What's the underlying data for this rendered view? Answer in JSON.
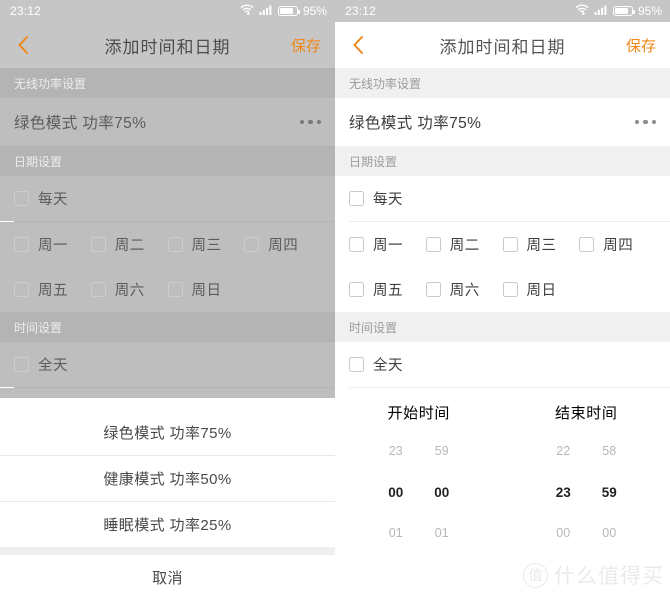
{
  "statusbar": {
    "time": "23:12",
    "battery_percent": "95%",
    "wifi_icon": "wifi-icon",
    "signal_icon": "signal-bars-icon",
    "battery_icon": "battery-icon"
  },
  "header": {
    "back_icon": "back-chevron-icon",
    "title": "添加时间和日期",
    "save_label": "保存",
    "accent_color": "#f0881a"
  },
  "sections": {
    "power": {
      "header": "无线功率设置",
      "row_label": "绿色模式 功率75%",
      "more_icon": "more-horizontal-icon"
    },
    "date": {
      "header": "日期设置",
      "all_days_label": "每天",
      "weekdays_row1": [
        "周一",
        "周二",
        "周三",
        "周四"
      ],
      "weekdays_row2": [
        "周五",
        "周六",
        "周日"
      ]
    },
    "time": {
      "header": "时间设置",
      "all_day_label": "全天",
      "start_title": "开始时间",
      "end_title": "结束时间",
      "start_hour": [
        "23",
        "00",
        "01"
      ],
      "start_minute": [
        "59",
        "00",
        "01"
      ],
      "end_hour": [
        "22",
        "23",
        "00"
      ],
      "end_minute": [
        "58",
        "59",
        "00"
      ]
    }
  },
  "action_sheet": {
    "options": [
      "绿色模式 功率75%",
      "健康模式 功率50%",
      "睡眠模式 功率25%"
    ],
    "cancel_label": "取消"
  },
  "watermark": {
    "badge": "值",
    "text": "什么值得买"
  }
}
